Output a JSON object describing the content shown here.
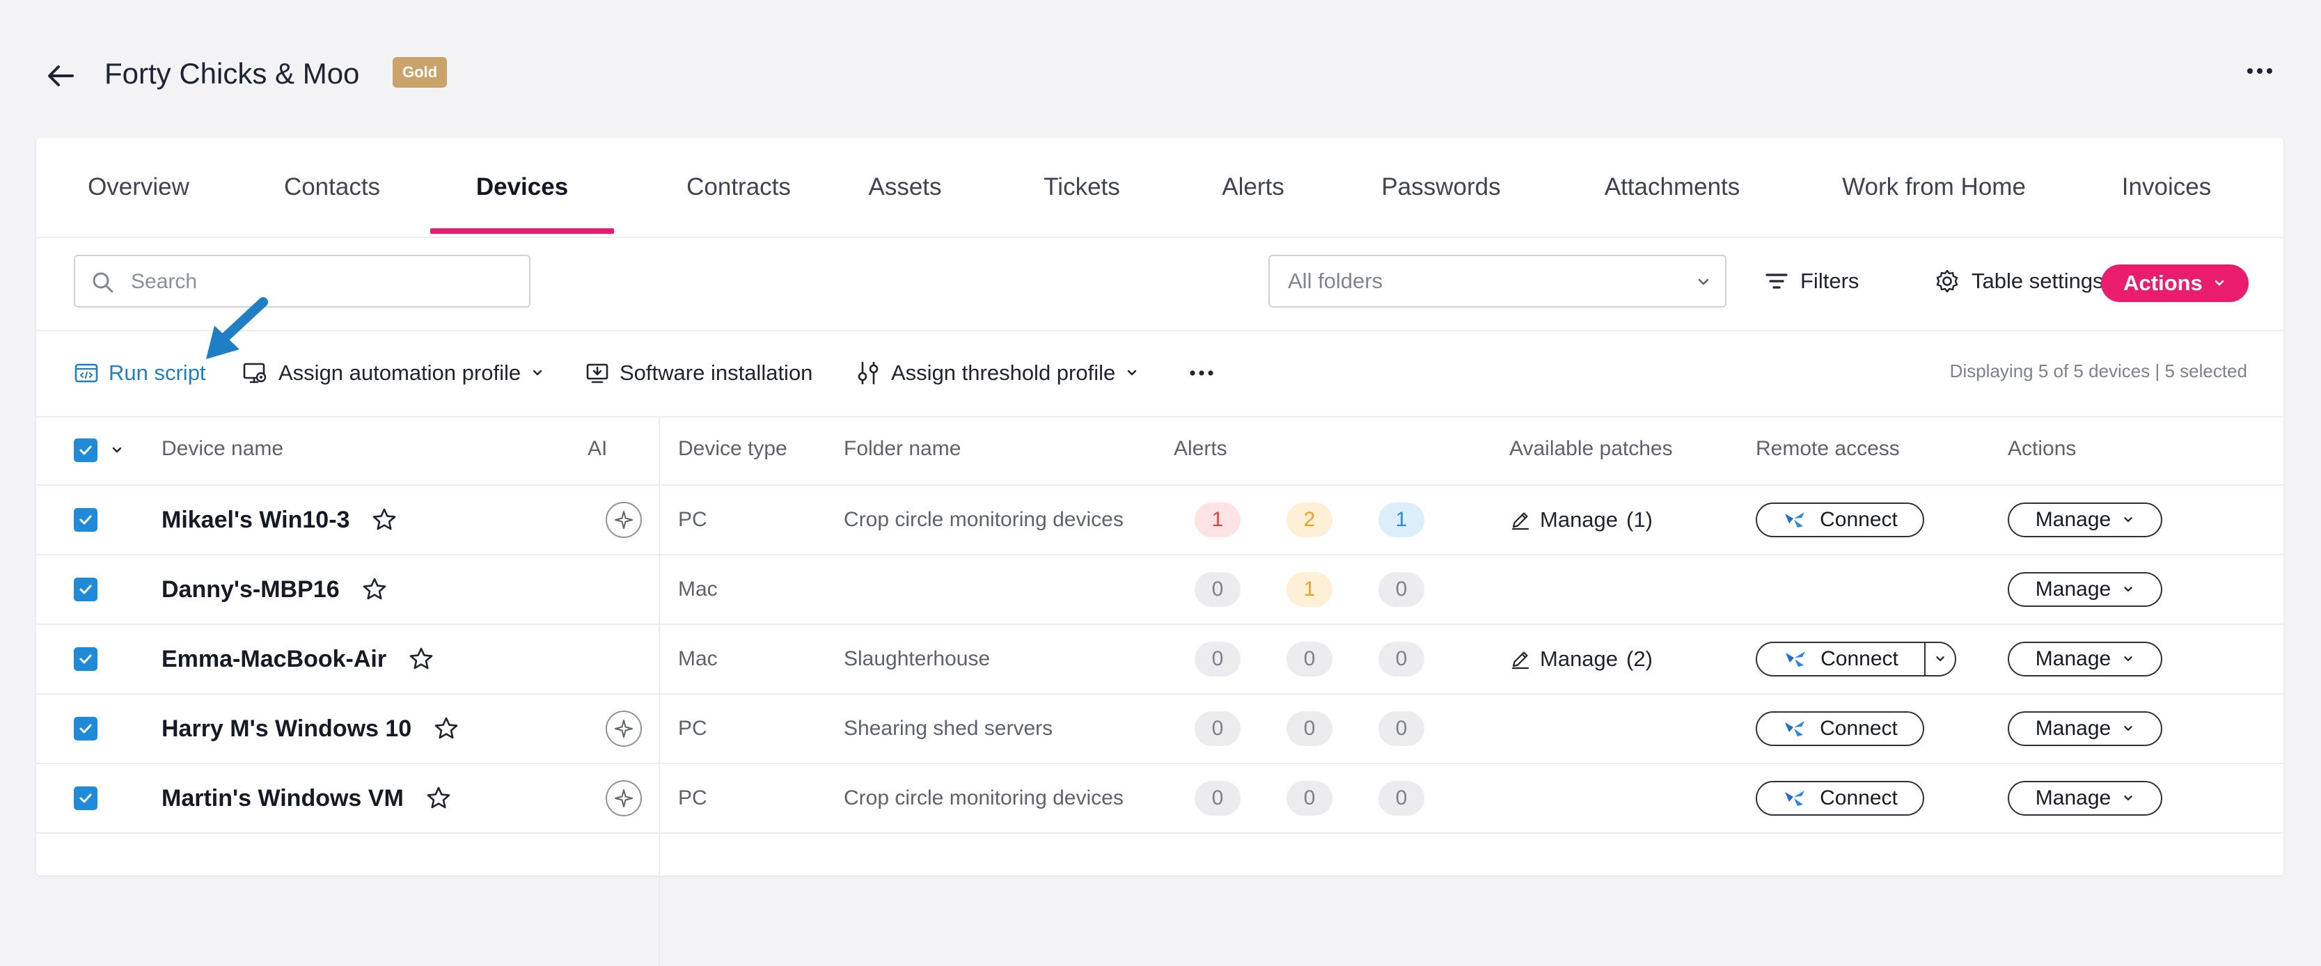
{
  "header": {
    "title": "Forty Chicks & Moo",
    "badge": "Gold"
  },
  "tabs": [
    {
      "label": "Overview"
    },
    {
      "label": "Contacts"
    },
    {
      "label": "Devices",
      "active": true
    },
    {
      "label": "Contracts"
    },
    {
      "label": "Assets"
    },
    {
      "label": "Tickets"
    },
    {
      "label": "Alerts"
    },
    {
      "label": "Passwords"
    },
    {
      "label": "Attachments"
    },
    {
      "label": "Work from Home"
    },
    {
      "label": "Invoices"
    }
  ],
  "filters": {
    "search_placeholder": "Search",
    "folder_select": "All folders",
    "filters_label": "Filters",
    "table_settings_label": "Table settings",
    "actions_label": "Actions"
  },
  "toolbar": {
    "run_script": "Run script",
    "assign_automation": "Assign automation profile",
    "software_installation": "Software installation",
    "assign_threshold": "Assign threshold profile",
    "display_info": "Displaying 5 of 5 devices | 5 selected"
  },
  "table": {
    "columns": {
      "device_name": "Device name",
      "ai": "AI",
      "device_type": "Device type",
      "folder_name": "Folder name",
      "alerts": "Alerts",
      "available_patches": "Available patches",
      "remote_access": "Remote access",
      "actions": "Actions"
    },
    "rows": [
      {
        "name": "Mikael's Win10-3",
        "ai": true,
        "type": "PC",
        "folder": "Crop circle monitoring devices",
        "alerts": [
          "1",
          "2",
          "1"
        ],
        "alert_colors": [
          "red",
          "orange",
          "blue"
        ],
        "patches": "Manage",
        "patch_count": "(1)",
        "connect": "Connect",
        "connect_split": false,
        "manage": "Manage"
      },
      {
        "name": "Danny's-MBP16",
        "ai": false,
        "type": "Mac",
        "folder": "",
        "alerts": [
          "0",
          "1",
          "0"
        ],
        "alert_colors": [
          "grey",
          "orange",
          "grey"
        ],
        "patches": "",
        "patch_count": "",
        "connect": "",
        "connect_split": false,
        "manage": "Manage"
      },
      {
        "name": "Emma-MacBook-Air",
        "ai": false,
        "type": "Mac",
        "folder": "Slaughterhouse",
        "alerts": [
          "0",
          "0",
          "0"
        ],
        "alert_colors": [
          "grey",
          "grey",
          "grey"
        ],
        "patches": "Manage",
        "patch_count": "(2)",
        "connect": "Connect",
        "connect_split": true,
        "manage": "Manage"
      },
      {
        "name": "Harry M's Windows 10",
        "ai": true,
        "type": "PC",
        "folder": "Shearing shed servers",
        "alerts": [
          "0",
          "0",
          "0"
        ],
        "alert_colors": [
          "grey",
          "grey",
          "grey"
        ],
        "patches": "",
        "patch_count": "",
        "connect": "Connect",
        "connect_split": false,
        "manage": "Manage"
      },
      {
        "name": "Martin's Windows VM",
        "ai": true,
        "type": "PC",
        "folder": "Crop circle monitoring devices",
        "alerts": [
          "0",
          "0",
          "0"
        ],
        "alert_colors": [
          "grey",
          "grey",
          "grey"
        ],
        "patches": "",
        "patch_count": "",
        "connect": "Connect",
        "connect_split": false,
        "manage": "Manage"
      }
    ]
  },
  "colors": {
    "accent_pink": "#ea1c6e",
    "link_blue": "#1f7fc6",
    "checkbox_blue": "#1f8ad8",
    "badge_gold": "#c9a36a",
    "alert_red_bg": "#fde3e3",
    "alert_red_fg": "#e0433f",
    "alert_orange_bg": "#fdf0d6",
    "alert_orange_fg": "#e5a323",
    "alert_blue_bg": "#ddeefb",
    "alert_blue_fg": "#2e8bd6",
    "alert_grey_bg": "#ececee",
    "alert_grey_fg": "#7c818b"
  }
}
